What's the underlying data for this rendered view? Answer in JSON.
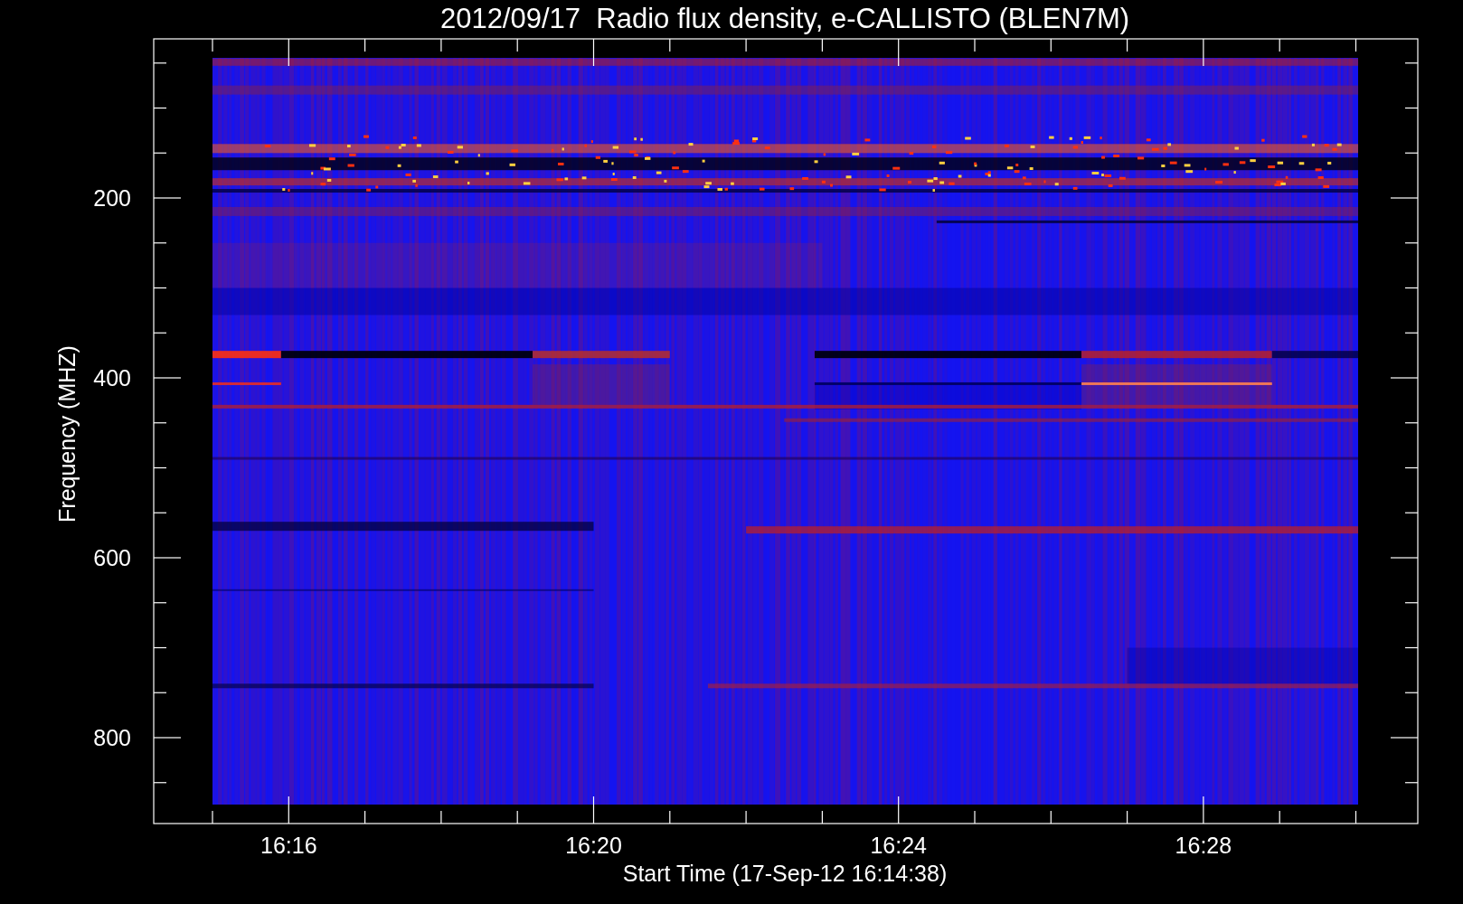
{
  "title": "2012/09/17  Radio flux density, e-CALLISTO (BLEN7M)",
  "y_axis": {
    "label": "Frequency (MHZ)",
    "ticks": [
      "200",
      "400",
      "600",
      "800"
    ]
  },
  "x_axis": {
    "label": "Start Time (17-Sep-12 16:14:38)",
    "ticks": [
      "16:16",
      "16:20",
      "16:24",
      "16:28"
    ]
  }
}
